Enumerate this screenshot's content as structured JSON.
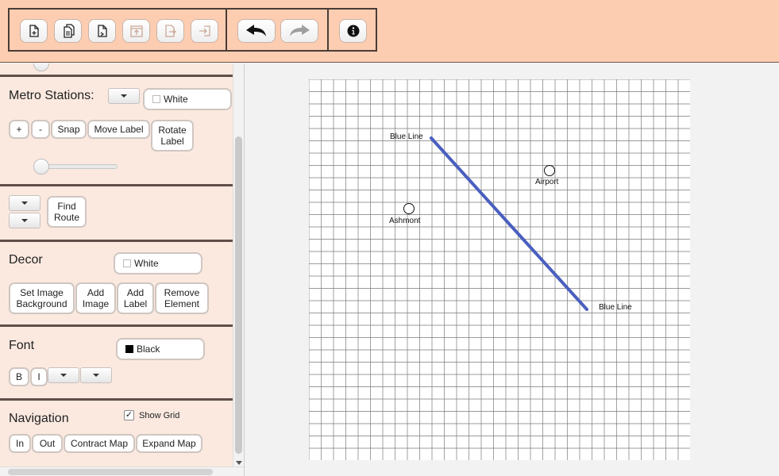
{
  "metro": {
    "heading": "Metro Stations:",
    "color_label": "White",
    "plus": "+",
    "minus": "-",
    "snap": "Snap",
    "move_label": "Move Label",
    "rotate_label": "Rotate Label",
    "slider_level": 0
  },
  "route": {
    "find_route": "Find Route"
  },
  "decor": {
    "heading": "Decor",
    "color_label": "White",
    "set_image_background": "Set Image Background",
    "add_image": "Add Image",
    "add_label": "Add Label",
    "remove_element": "Remove Element"
  },
  "font": {
    "heading": "Font",
    "color_label": "Black",
    "bold": "B",
    "italic": "I"
  },
  "navigation": {
    "heading": "Navigation",
    "show_grid_label": "Show Grid",
    "show_grid_checked": true,
    "zoom_in": "In",
    "zoom_out": "Out",
    "contract_map": "Contract Map",
    "expand_map": "Expand Map"
  },
  "map": {
    "line_color": "#4a5fbf",
    "line_start_label": "Blue Line",
    "line_end_label": "Blue Line",
    "stations": [
      {
        "name": "Airport"
      },
      {
        "name": "Ashmont"
      }
    ]
  },
  "colors": {
    "toolbar_bg": "#fdcdb2",
    "panel_bg": "#fbe9e0"
  },
  "toolbar_icons": [
    "new-file-icon",
    "copy-icon",
    "open-file-icon",
    "save-image-icon",
    "export-icon",
    "exit-icon",
    "undo-icon",
    "redo-icon",
    "info-icon"
  ]
}
